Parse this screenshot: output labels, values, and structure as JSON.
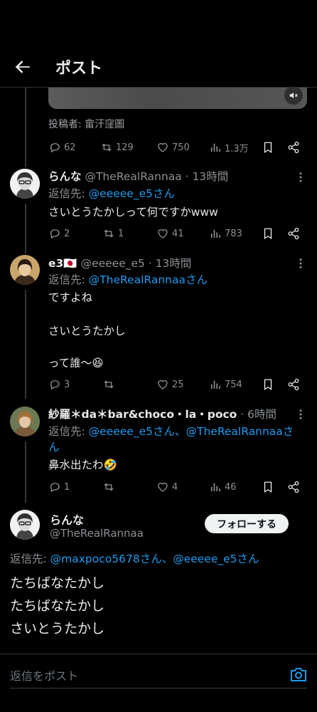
{
  "header": {
    "title": "ポスト"
  },
  "parent_post": {
    "caption": "投稿者: 畲汗窪圖",
    "stats": {
      "replies": "62",
      "reposts": "129",
      "likes": "750",
      "views": "1.3万"
    }
  },
  "replies": [
    {
      "name": "らんな",
      "handle": "@TheRealRannaa",
      "time": "· 13時間",
      "reply_label": "返信先: ",
      "reply_targets": "@eeeee_e5さん",
      "reply_targets_2": "",
      "lines": [
        "さいとうたかしって何ですかwww"
      ],
      "stats": {
        "replies": "2",
        "reposts": "1",
        "likes": "41",
        "views": "783"
      }
    },
    {
      "name": "e3🇯🇵",
      "handle": "@eeeee_e5",
      "time": "· 13時間",
      "reply_label": "返信先: ",
      "reply_targets": "@TheRealRannaaさん",
      "reply_targets_2": "",
      "lines": [
        "ですよね",
        "さいとうたかし",
        "って誰〜😆"
      ],
      "stats": {
        "replies": "3",
        "reposts": "",
        "likes": "25",
        "views": "754"
      }
    },
    {
      "name": "紗羅＊da＊bar&choco・la・poco",
      "handle": "",
      "time": "· 6時間",
      "reply_label": "返信先: ",
      "reply_targets": "@eeeee_e5さん、@TheRealRannaaさ",
      "reply_targets_2": "ん",
      "lines": [
        "鼻水出たわ🤣"
      ],
      "stats": {
        "replies": "1",
        "reposts": "",
        "likes": "4",
        "views": "46"
      }
    }
  ],
  "main_post": {
    "name": "らんな",
    "handle": "@TheRealRannaa",
    "follow_label": "フォローする",
    "reply_label": "返信先: ",
    "reply_targets": "@maxpoco5678さん、@eeeee_e5さん",
    "lines": [
      "たちばなたかし",
      "たちばなたかし",
      "さいとうたかし"
    ]
  },
  "composer": {
    "placeholder": "返信をポスト"
  },
  "colors": {
    "background": "#000000",
    "link": "#1d9bf0",
    "muted": "#8b9095",
    "text": "#e7e9ea"
  }
}
